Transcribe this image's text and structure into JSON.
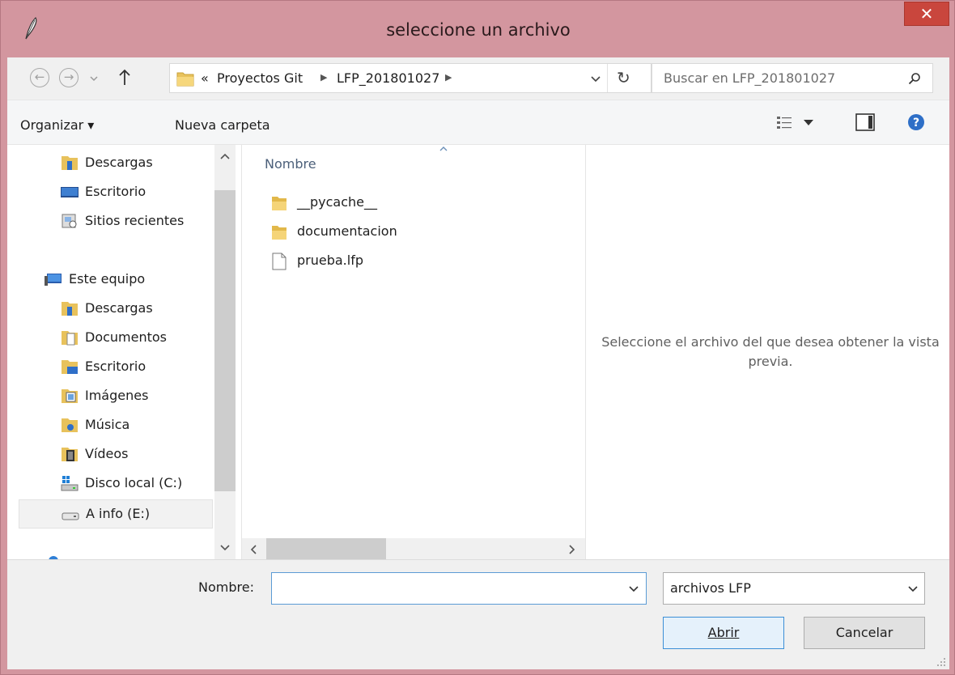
{
  "window": {
    "title": "seleccione un archivo",
    "close_glyph": "✕"
  },
  "address": {
    "overflow": "«",
    "breadcrumbs": [
      "Proyectos Git",
      "LFP_201801027"
    ],
    "refresh_glyph": "↻",
    "search_placeholder": "Buscar en LFP_201801027"
  },
  "toolbar": {
    "organize_label": "Organizar ▾",
    "new_folder_label": "Nueva carpeta"
  },
  "sidebar": {
    "items": [
      {
        "label": "Descargas",
        "icon": "downloads-folder-icon"
      },
      {
        "label": "Escritorio",
        "icon": "desktop-icon"
      },
      {
        "label": "Sitios recientes",
        "icon": "recent-places-icon"
      },
      {
        "label": "Este equipo",
        "icon": "computer-icon"
      },
      {
        "label": "Descargas",
        "icon": "downloads-folder-icon"
      },
      {
        "label": "Documentos",
        "icon": "documents-icon"
      },
      {
        "label": "Escritorio",
        "icon": "desktop-folder-icon"
      },
      {
        "label": "Imágenes",
        "icon": "pictures-icon"
      },
      {
        "label": "Música",
        "icon": "music-icon"
      },
      {
        "label": "Vídeos",
        "icon": "videos-icon"
      },
      {
        "label": "Disco local (C:)",
        "icon": "local-disk-icon"
      },
      {
        "label": "A info (E:)",
        "icon": "removable-drive-icon"
      }
    ]
  },
  "files": {
    "column_header": "Nombre",
    "items": [
      {
        "name": "__pycache__",
        "type": "folder"
      },
      {
        "name": "documentacion",
        "type": "folder"
      },
      {
        "name": "prueba.lfp",
        "type": "file"
      }
    ]
  },
  "preview": {
    "message": "Seleccione el archivo del que desea obtener la vista previa."
  },
  "bottom": {
    "filename_label": "Nombre:",
    "filename_value": "",
    "filetype_value": "archivos LFP",
    "open_label": "Abrir",
    "cancel_label": "Cancelar"
  },
  "colors": {
    "frame": "#d3969f",
    "close": "#c9463d",
    "focus": "#5b9bd5"
  }
}
